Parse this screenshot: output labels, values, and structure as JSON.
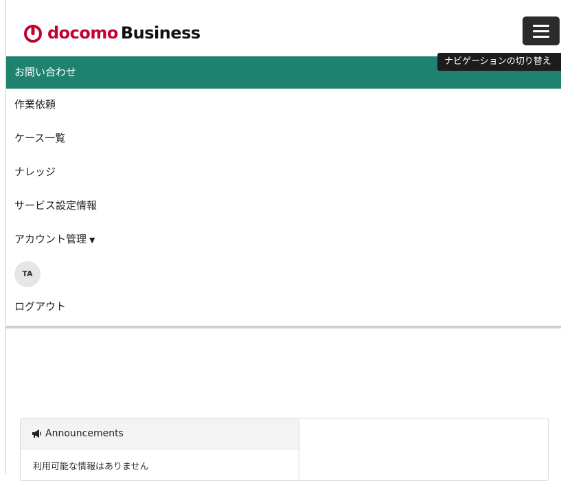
{
  "header": {
    "logo_main": "docomo",
    "logo_secondary": "Business",
    "toggle_tooltip": "ナビゲーションの切り替え"
  },
  "nav": {
    "items": [
      {
        "label": "お問い合わせ",
        "active": true
      },
      {
        "label": "作業依頼"
      },
      {
        "label": "ケース一覧"
      },
      {
        "label": "ナレッジ"
      },
      {
        "label": "サービス設定情報"
      },
      {
        "label": "アカウント管理"
      }
    ],
    "avatar_initials": "TA",
    "logout_label": "ログアウト"
  },
  "announcements": {
    "title": "Announcements",
    "empty_message": "利用可能な情報はありません"
  },
  "colors": {
    "accent": "#1f826e",
    "brand": "#c3002f"
  }
}
